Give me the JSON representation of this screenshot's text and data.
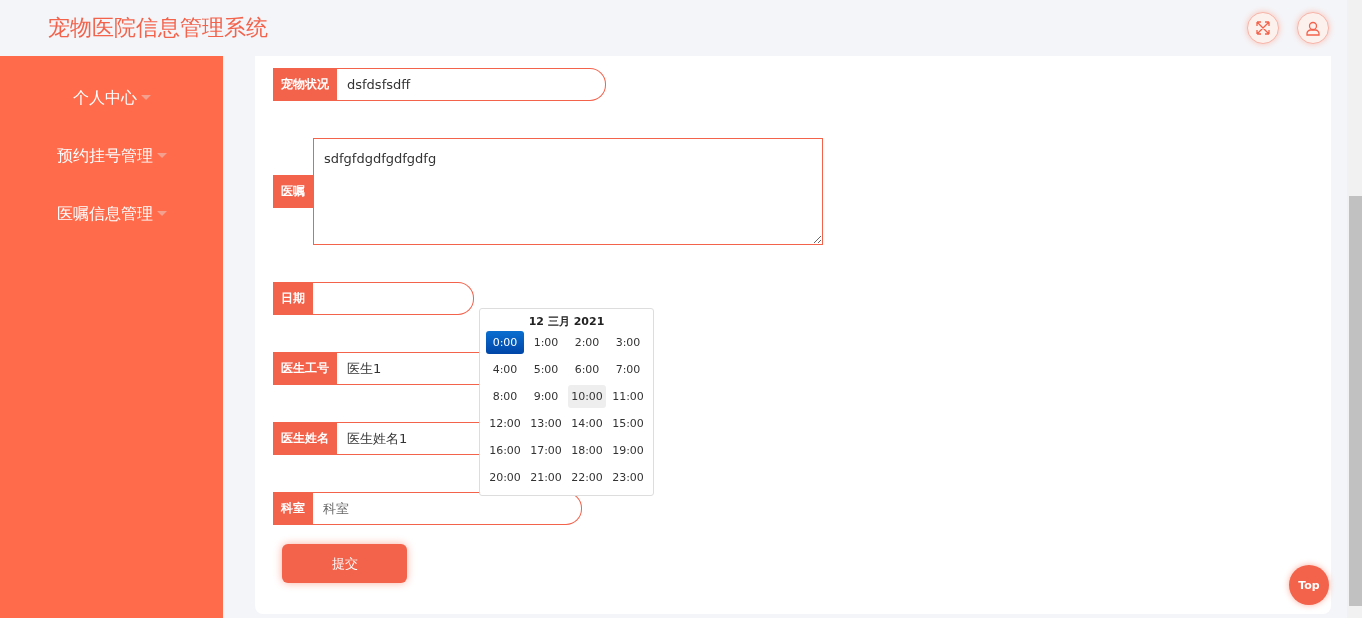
{
  "header": {
    "title": "宠物医院信息管理系统"
  },
  "sidebar": {
    "items": [
      {
        "label": "个人中心"
      },
      {
        "label": "预约挂号管理"
      },
      {
        "label": "医嘱信息管理"
      }
    ]
  },
  "form": {
    "fields": [
      {
        "kind": "input",
        "label": "宠物状况",
        "value": "dsfdsfsdff"
      },
      {
        "kind": "textarea",
        "label": "医嘱",
        "value": "sdfgfdgdfgdfgdfg"
      },
      {
        "kind": "input",
        "label": "日期",
        "time_picker": {
          "title": "12 三月 2021",
          "hours": [
            {
              "label": "0:00",
              "selected": true,
              "hovered": false
            },
            {
              "label": "1:00",
              "selected": false,
              "hovered": false
            },
            {
              "label": "2:00",
              "selected": false,
              "hovered": false
            },
            {
              "label": "3:00",
              "selected": false,
              "hovered": false
            },
            {
              "label": "4:00",
              "selected": false,
              "hovered": false
            },
            {
              "label": "5:00",
              "selected": false,
              "hovered": false
            },
            {
              "label": "6:00",
              "selected": false,
              "hovered": false
            },
            {
              "label": "7:00",
              "selected": false,
              "hovered": false
            },
            {
              "label": "8:00",
              "selected": false,
              "hovered": false
            },
            {
              "label": "9:00",
              "selected": false,
              "hovered": false
            },
            {
              "label": "10:00",
              "selected": false,
              "hovered": true
            },
            {
              "label": "11:00",
              "selected": false,
              "hovered": false
            },
            {
              "label": "12:00",
              "selected": false,
              "hovered": false
            },
            {
              "label": "13:00",
              "selected": false,
              "hovered": false
            },
            {
              "label": "14:00",
              "selected": false,
              "hovered": false
            },
            {
              "label": "15:00",
              "selected": false,
              "hovered": false
            },
            {
              "label": "16:00",
              "selected": false,
              "hovered": false
            },
            {
              "label": "17:00",
              "selected": false,
              "hovered": false
            },
            {
              "label": "18:00",
              "selected": false,
              "hovered": false
            },
            {
              "label": "19:00",
              "selected": false,
              "hovered": false
            },
            {
              "label": "20:00",
              "selected": false,
              "hovered": false
            },
            {
              "label": "21:00",
              "selected": false,
              "hovered": false
            },
            {
              "label": "22:00",
              "selected": false,
              "hovered": false
            },
            {
              "label": "23:00",
              "selected": false,
              "hovered": false
            }
          ]
        }
      },
      {
        "kind": "input",
        "label": "医生工号",
        "value": "医生1"
      },
      {
        "kind": "input",
        "label": "医生姓名",
        "value": "医生姓名1"
      },
      {
        "kind": "input",
        "label": "科室",
        "placeholder": "科室"
      }
    ],
    "submit": "提交"
  },
  "back_to_top": "Top"
}
